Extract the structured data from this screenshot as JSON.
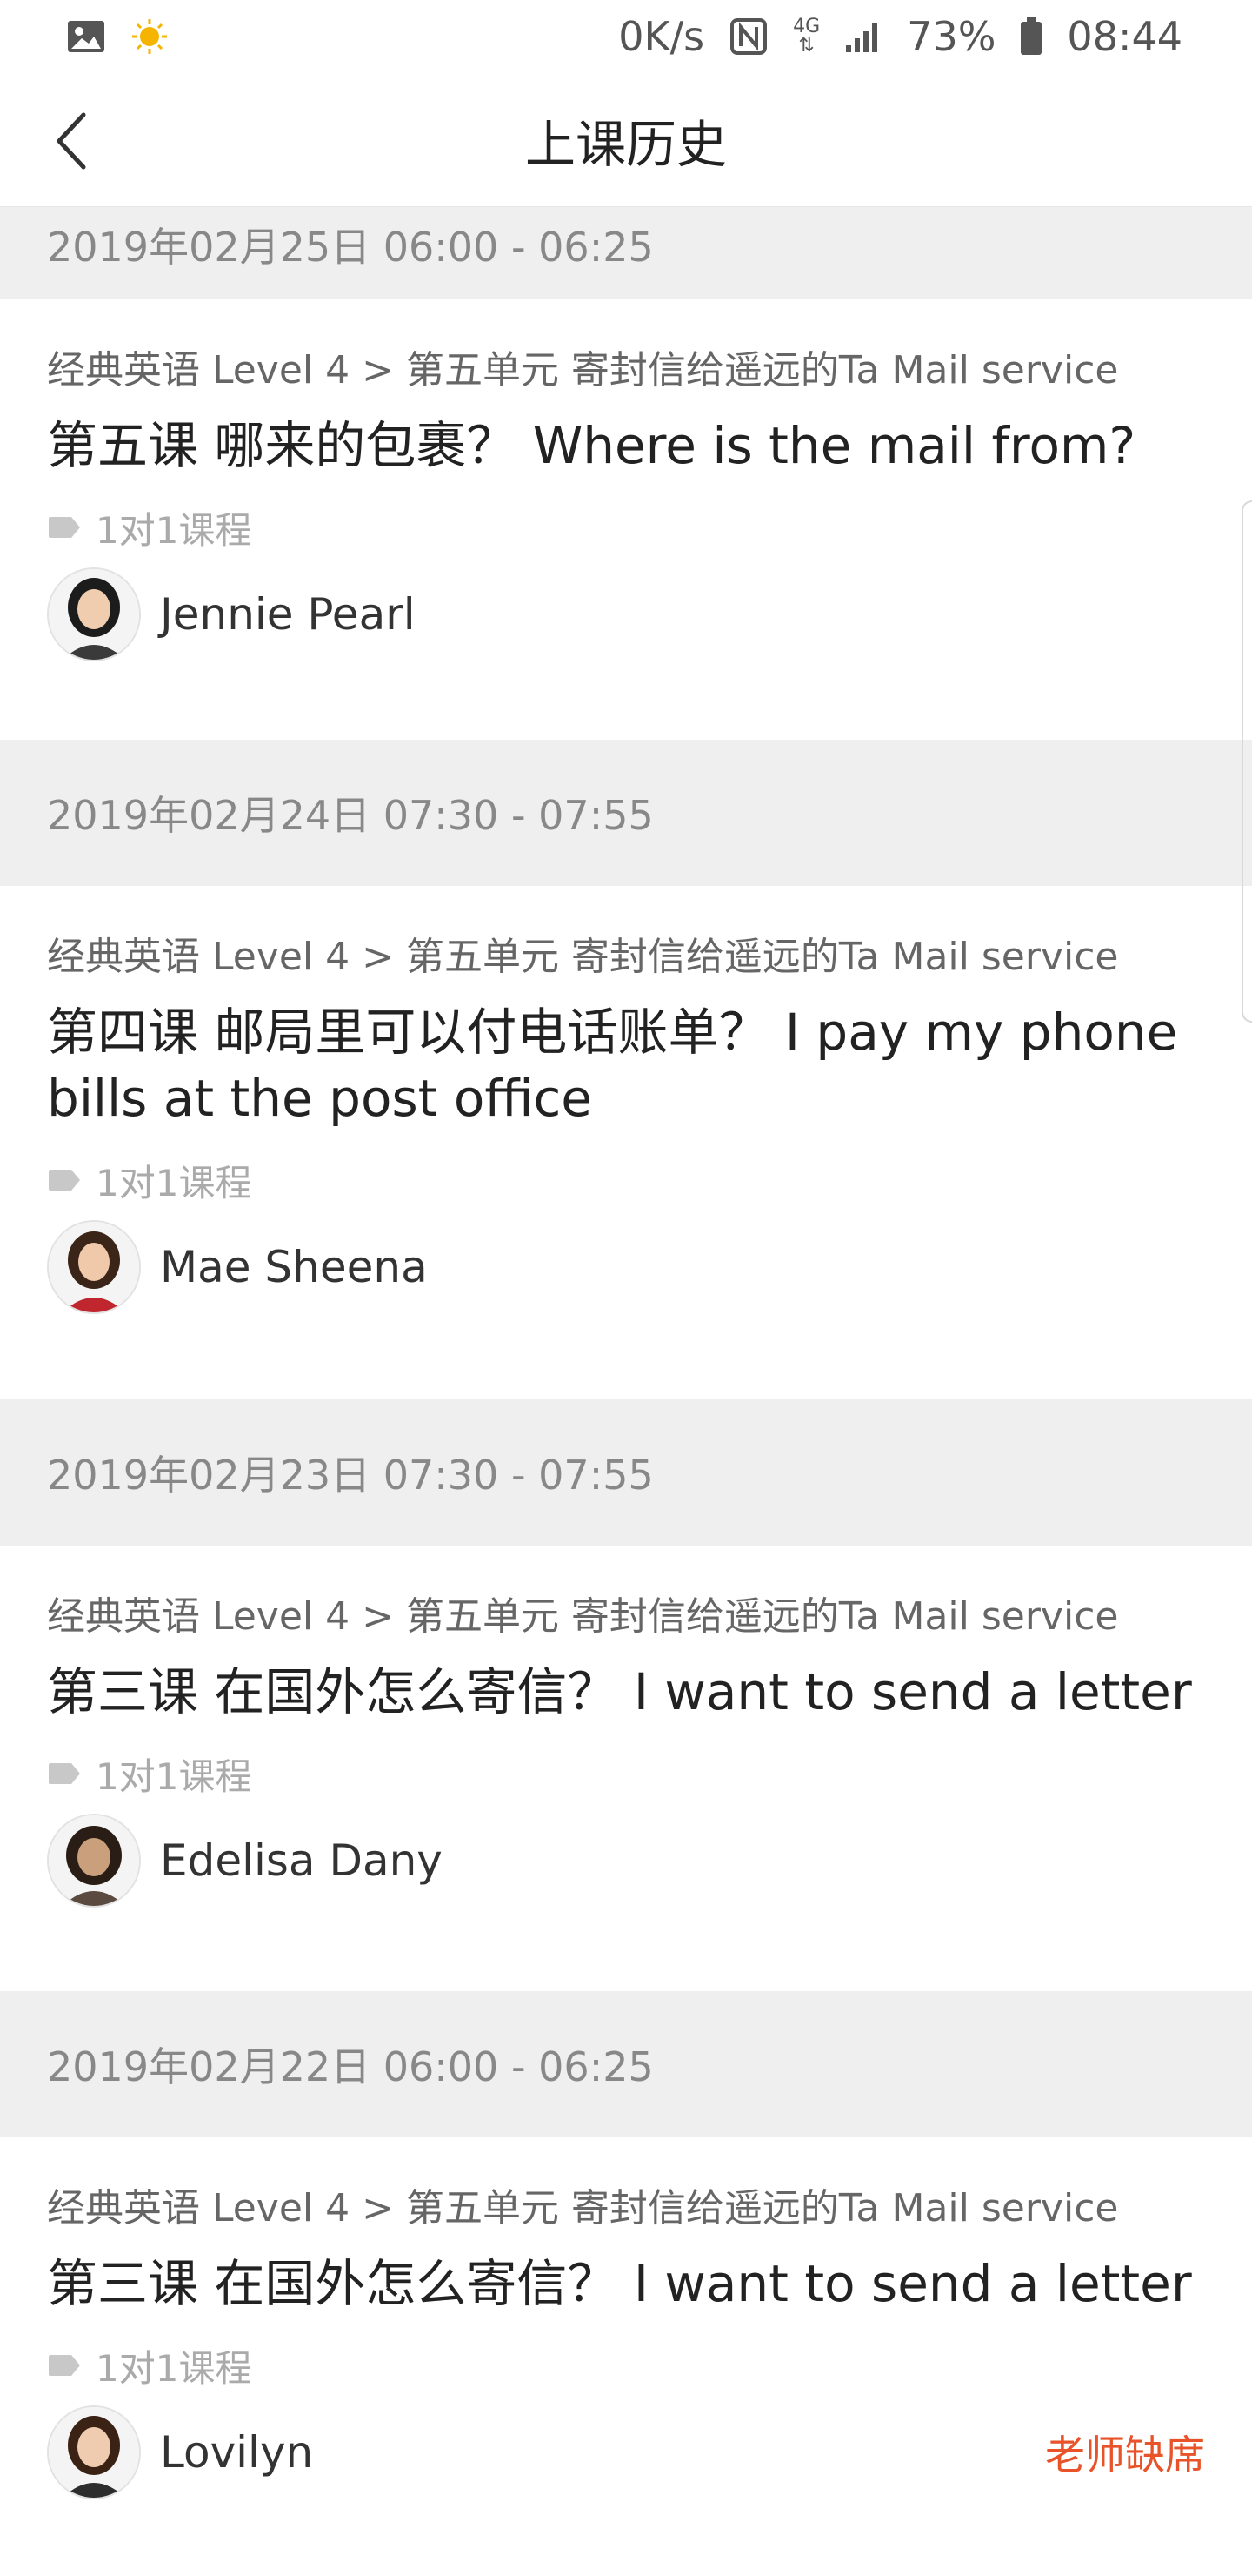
{
  "status_bar": {
    "net_speed": "0K/s",
    "network": "4G",
    "battery": "73%",
    "time": "08:44",
    "icons": [
      "image-icon",
      "sun-icon",
      "nfc-icon",
      "signal-icon",
      "battery-icon"
    ]
  },
  "header": {
    "title": "上课历史",
    "back_icon": "chevron-left-icon"
  },
  "sessions": [
    {
      "date": "2019年02月25日 06:00 - 06:25",
      "course_path": "经典英语 Level 4 > 第五单元 寄封信给遥远的Ta Mail service",
      "lesson": "第五课 哪来的包裹？ Where is the mail from?",
      "tag": "1对1课程",
      "teacher": "Jennie Pearl",
      "status": ""
    },
    {
      "date": "2019年02月24日 07:30 - 07:55",
      "course_path": "经典英语 Level 4 > 第五单元 寄封信给遥远的Ta Mail service",
      "lesson": "第四课 邮局里可以付电话账单？ I pay my phone bills at the post office",
      "tag": "1对1课程",
      "teacher": "Mae Sheena",
      "status": ""
    },
    {
      "date": "2019年02月23日 07:30 - 07:55",
      "course_path": "经典英语 Level 4 > 第五单元 寄封信给遥远的Ta Mail service",
      "lesson": "第三课 在国外怎么寄信？ I want to send a letter",
      "tag": "1对1课程",
      "teacher": "Edelisa Dany",
      "status": ""
    },
    {
      "date": "2019年02月22日 06:00 - 06:25",
      "course_path": "经典英语 Level 4 > 第五单元 寄封信给遥远的Ta Mail service",
      "lesson": "第三课 在国外怎么寄信？ I want to send a letter",
      "tag": "1对1课程",
      "teacher": "Lovilyn",
      "status": "老师缺席"
    }
  ],
  "colors": {
    "accent": "#e8532a",
    "header_bg": "#efefef"
  }
}
